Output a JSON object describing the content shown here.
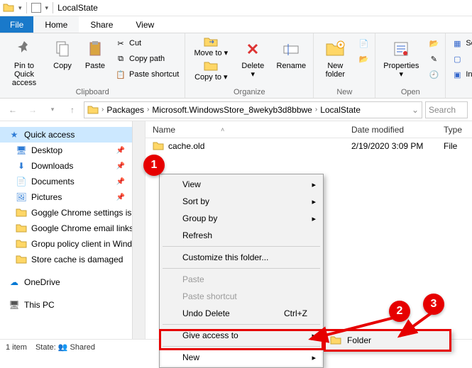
{
  "window": {
    "title": "LocalState"
  },
  "menubar": {
    "file": "File",
    "tabs": [
      "Home",
      "Share",
      "View"
    ],
    "active": 0
  },
  "ribbon": {
    "clipboard": {
      "label": "Clipboard",
      "pin": "Pin to Quick access",
      "copy": "Copy",
      "paste": "Paste",
      "cut": "Cut",
      "copy_path": "Copy path",
      "paste_shortcut": "Paste shortcut"
    },
    "organize": {
      "label": "Organize",
      "move_to": "Move to",
      "copy_to": "Copy to",
      "delete": "Delete",
      "rename": "Rename"
    },
    "new": {
      "label": "New",
      "new_folder": "New folder"
    },
    "open": {
      "label": "Open",
      "properties": "Properties"
    },
    "select": {
      "select_all": "Select",
      "invert": "Invert"
    }
  },
  "address": {
    "segments": [
      "Packages",
      "Microsoft.WindowsStore_8wekyb3d8bbwe",
      "LocalState"
    ]
  },
  "search": {
    "placeholder": "Search"
  },
  "sidebar": {
    "quick_access": "Quick access",
    "items": [
      {
        "label": "Desktop",
        "pinned": true,
        "icon": "desktop"
      },
      {
        "label": "Downloads",
        "pinned": true,
        "icon": "downloads"
      },
      {
        "label": "Documents",
        "pinned": true,
        "icon": "documents"
      },
      {
        "label": "Pictures",
        "pinned": true,
        "icon": "pictures"
      },
      {
        "label": "Goggle Chrome settings is b",
        "pinned": false,
        "icon": "folder"
      },
      {
        "label": "Google Chrome email links",
        "pinned": false,
        "icon": "folder"
      },
      {
        "label": "Gropu policy client in Windo",
        "pinned": false,
        "icon": "folder"
      },
      {
        "label": "Store cache is damaged",
        "pinned": false,
        "icon": "folder"
      }
    ],
    "onedrive": "OneDrive",
    "this_pc": "This PC"
  },
  "columns": {
    "name": "Name",
    "date": "Date modified",
    "type": "Type"
  },
  "rows": [
    {
      "name": "cache.old",
      "date": "2/19/2020 3:09 PM",
      "type": "File"
    }
  ],
  "statusbar": {
    "items": "1 item",
    "state_label": "State:",
    "state_value": "Shared"
  },
  "context_menu": {
    "view": "View",
    "sort_by": "Sort by",
    "group_by": "Group by",
    "refresh": "Refresh",
    "customize": "Customize this folder...",
    "paste": "Paste",
    "paste_shortcut": "Paste shortcut",
    "undo_delete": "Undo Delete",
    "undo_shortcut": "Ctrl+Z",
    "give_access": "Give access to",
    "new": "New"
  },
  "submenu": {
    "folder": "Folder"
  },
  "annotations": {
    "n1": "1",
    "n2": "2",
    "n3": "3"
  }
}
